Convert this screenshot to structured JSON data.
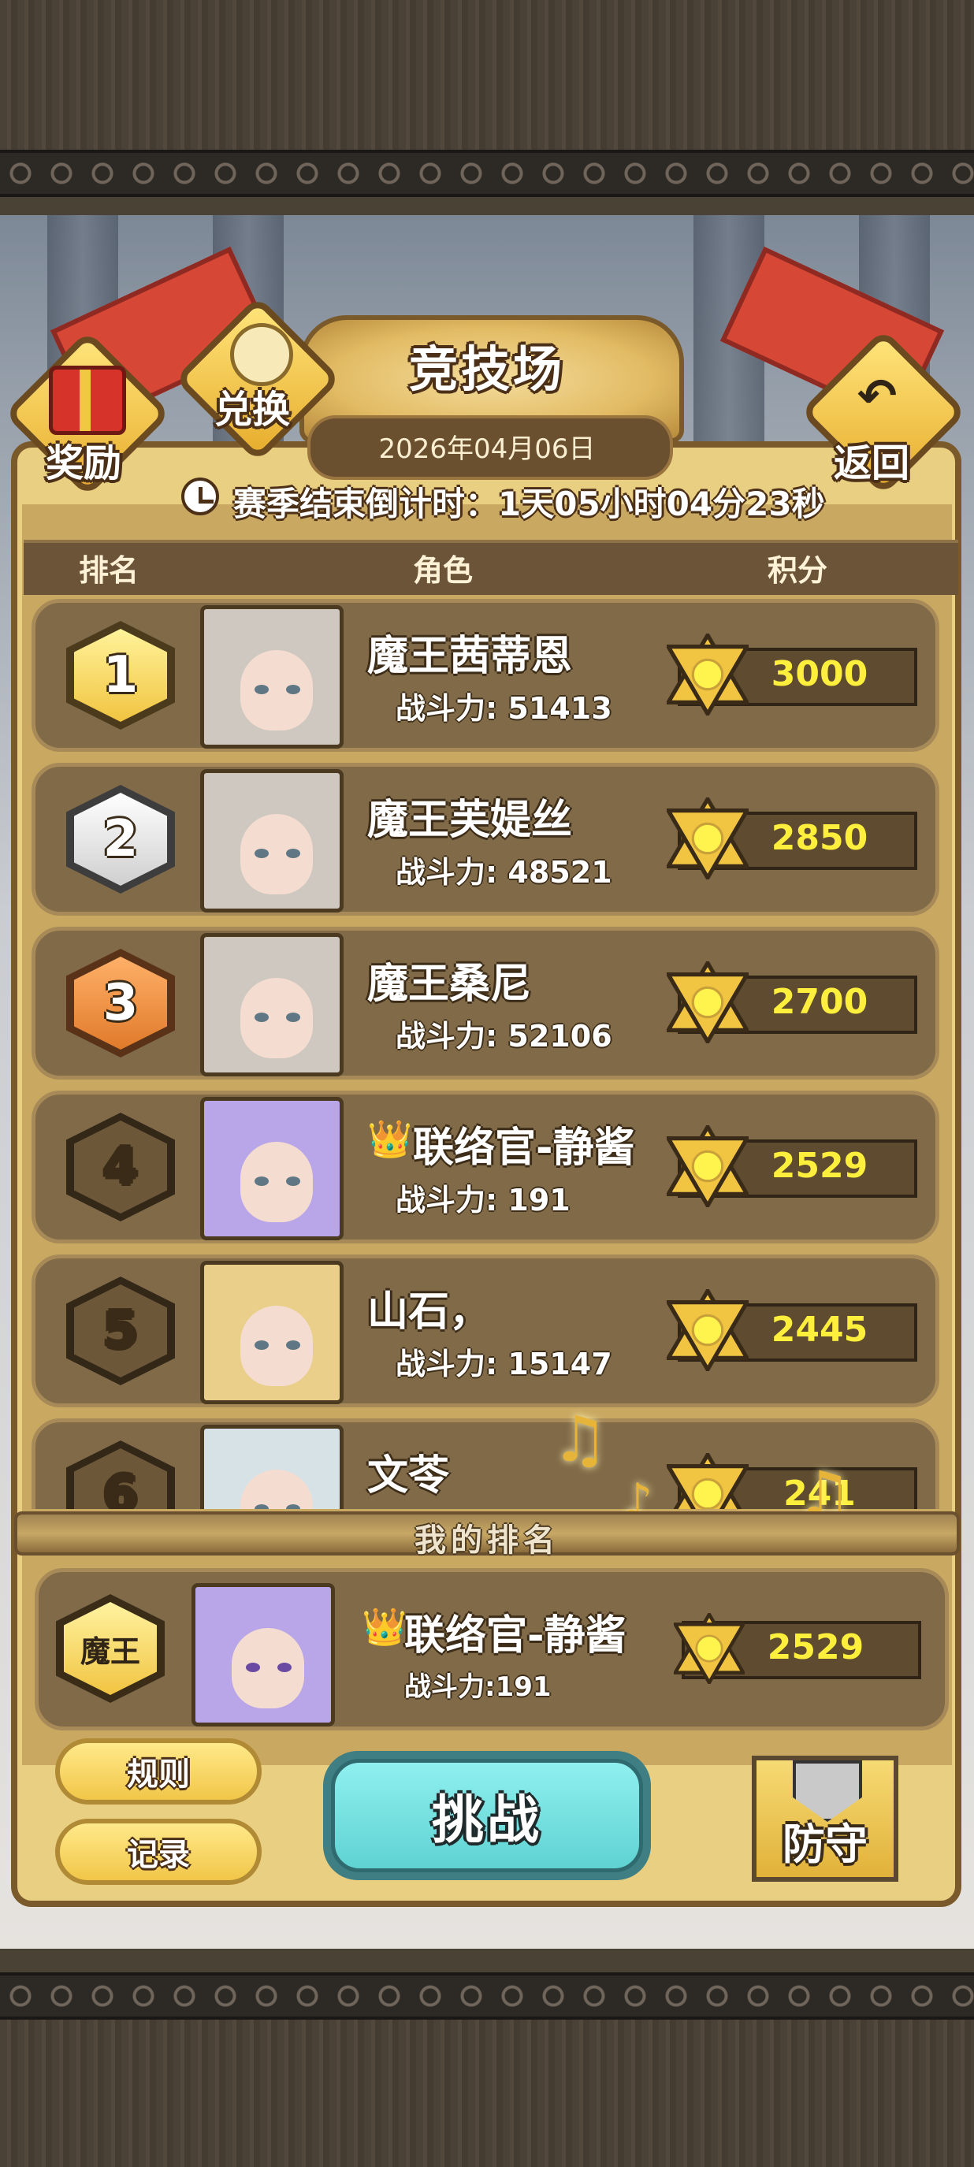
{
  "header": {
    "title": "竞技场",
    "date": "2026年04月06日",
    "countdown": "赛季结束倒计时：1天05小时04分23秒",
    "reward_label": "奖励",
    "exchange_label": "兑换",
    "back_label": "返回"
  },
  "columns": {
    "rank": "排名",
    "role": "角色",
    "score": "积分"
  },
  "rankings": [
    {
      "rank": "1",
      "name": "魔王茜蒂恩",
      "power": "战斗力: 51413",
      "score": "3000"
    },
    {
      "rank": "2",
      "name": "魔王芙媞丝",
      "power": "战斗力: 48521",
      "score": "2850"
    },
    {
      "rank": "3",
      "name": "魔王桑尼",
      "power": "战斗力: 52106",
      "score": "2700"
    },
    {
      "rank": "4",
      "name": "联络官-静酱",
      "power": "战斗力: 191",
      "score": "2529"
    },
    {
      "rank": "5",
      "name": "山石，",
      "power": "战斗力: 15147",
      "score": "2445"
    },
    {
      "rank": "6",
      "name": "文苓",
      "power": "",
      "score": "241"
    }
  ],
  "my_rank": {
    "section_title": "我的排名",
    "rank_badge": "魔王",
    "name": "联络官-静酱",
    "power": "战斗力:191",
    "score": "2529"
  },
  "footer": {
    "rules_label": "规则",
    "record_label": "记录",
    "challenge_label": "挑战",
    "defend_label": "防守"
  },
  "colors": {
    "gold": "#f1c648",
    "silver": "#e6e6e6",
    "bronze": "#e48a3a",
    "score_text": "#ffef3d",
    "challenge": "#5fd2d2"
  }
}
